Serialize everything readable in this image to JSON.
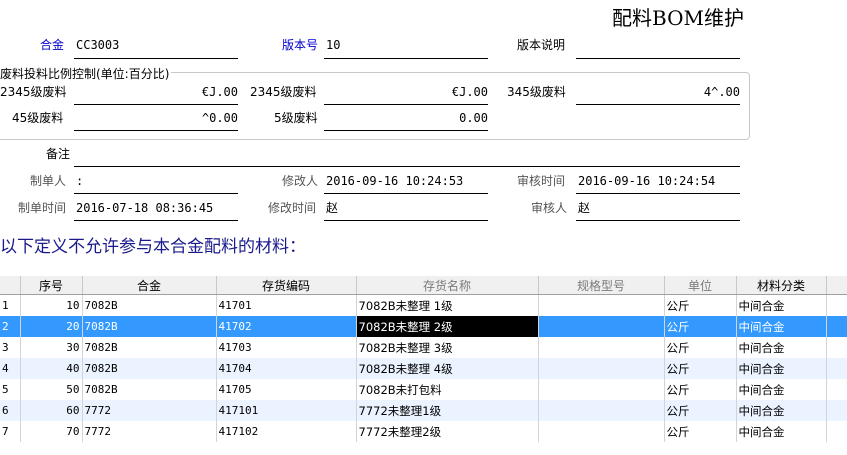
{
  "window": {
    "title": "配料BOM维护"
  },
  "header": {
    "alloy_label": "合金",
    "alloy_value": "CC3003",
    "version_label": "版本号",
    "version_value": "10",
    "version_desc_label": "版本说明",
    "version_desc_value": ""
  },
  "waste_group": {
    "title": "废料投料比例控制(单位:百分比)",
    "row1": [
      {
        "label": "2345级废料",
        "value": "€J.00"
      },
      {
        "label": "2345级废料",
        "value": "€J.00"
      },
      {
        "label": "345级废料",
        "value": "4^.00"
      }
    ],
    "row2": [
      {
        "label": "45级废料",
        "value": "^0.00"
      },
      {
        "label": "5级废料",
        "value": "0.00"
      }
    ]
  },
  "remark": {
    "label": "备注",
    "value": ""
  },
  "audit": {
    "creator_label": "制单人",
    "creator_value": ":",
    "modifier_label": "修改人",
    "modifier_value": "2016-09-16 10:24:53",
    "review_time_label": "审核时间",
    "review_time_value": "2016-09-16 10:24:54",
    "create_time_label": "制单时间",
    "create_time_value": "2016-07-18 08:36:45",
    "modify_time_label": "修改时间",
    "modify_time_value": "赵",
    "reviewer_label": "审核人",
    "reviewer_value": "赵"
  },
  "section_heading": "以下定义不允许参与本合金配料的材料：",
  "grid": {
    "columns": [
      "序号",
      "合金",
      "存货编码",
      "存货名称",
      "规格型号",
      "单位",
      "材料分类"
    ],
    "rows": [
      {
        "row_no": "1",
        "seq": "10",
        "alloy": "7082B",
        "code": "41701",
        "name": "7082B未整理 1级",
        "spec": "",
        "unit": "公斤",
        "category": "中间合金"
      },
      {
        "row_no": "2",
        "seq": "20",
        "alloy": "7082B",
        "code": "41702",
        "name": "7082B未整理 2级",
        "spec": "",
        "unit": "公斤",
        "category": "中间合金"
      },
      {
        "row_no": "3",
        "seq": "30",
        "alloy": "7082B",
        "code": "41703",
        "name": "7082B未整理 3级",
        "spec": "",
        "unit": "公斤",
        "category": "中间合金"
      },
      {
        "row_no": "4",
        "seq": "40",
        "alloy": "7082B",
        "code": "41704",
        "name": "7082B未整理 4级",
        "spec": "",
        "unit": "公斤",
        "category": "中间合金"
      },
      {
        "row_no": "5",
        "seq": "50",
        "alloy": "7082B",
        "code": "41705",
        "name": "7082B未打包料",
        "spec": "",
        "unit": "公斤",
        "category": "中间合金"
      },
      {
        "row_no": "6",
        "seq": "60",
        "alloy": "7772",
        "code": "417101",
        "name": "7772未整理1级",
        "spec": "",
        "unit": "公斤",
        "category": "中间合金"
      },
      {
        "row_no": "7",
        "seq": "70",
        "alloy": "7772",
        "code": "417102",
        "name": "7772未整理2级",
        "spec": "",
        "unit": "公斤",
        "category": "中间合金"
      }
    ]
  }
}
